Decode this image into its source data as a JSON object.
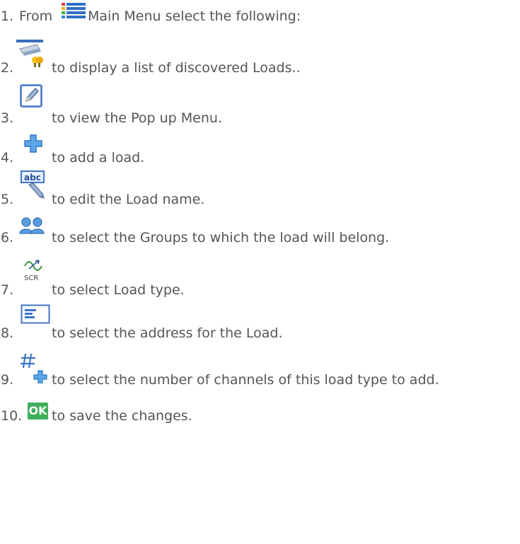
{
  "steps": [
    {
      "number": "1.",
      "prefix": "From",
      "text": "Main Menu select the following:",
      "icon": "main-menu-icon"
    },
    {
      "number": "2.",
      "text": "to display a list of discovered Loads..",
      "icon": "loads-list-icon"
    },
    {
      "number": "3.",
      "text": "to view the Pop up Menu.",
      "icon": "edit-pencil-icon"
    },
    {
      "number": "4.",
      "text": "to add a load.",
      "icon": "add-plus-icon"
    },
    {
      "number": "5.",
      "text": "to edit the Load name.",
      "icon": "abc-rename-icon"
    },
    {
      "number": "6.",
      "text": "to select the Groups to which the load will belong.",
      "icon": "groups-icon"
    },
    {
      "number": "7.",
      "text": "to select Load type.",
      "icon": "scr-load-type-icon",
      "icon_label": "SCR"
    },
    {
      "number": "8.",
      "text": "to select the address for the Load.",
      "icon": "address-field-icon"
    },
    {
      "number": "9.",
      "text": "to select the number of channels of this load type to add.",
      "icon": "channels-count-icon"
    },
    {
      "number": "10.",
      "text": "to save the changes.",
      "icon": "ok-button-icon",
      "icon_label": "OK"
    }
  ]
}
